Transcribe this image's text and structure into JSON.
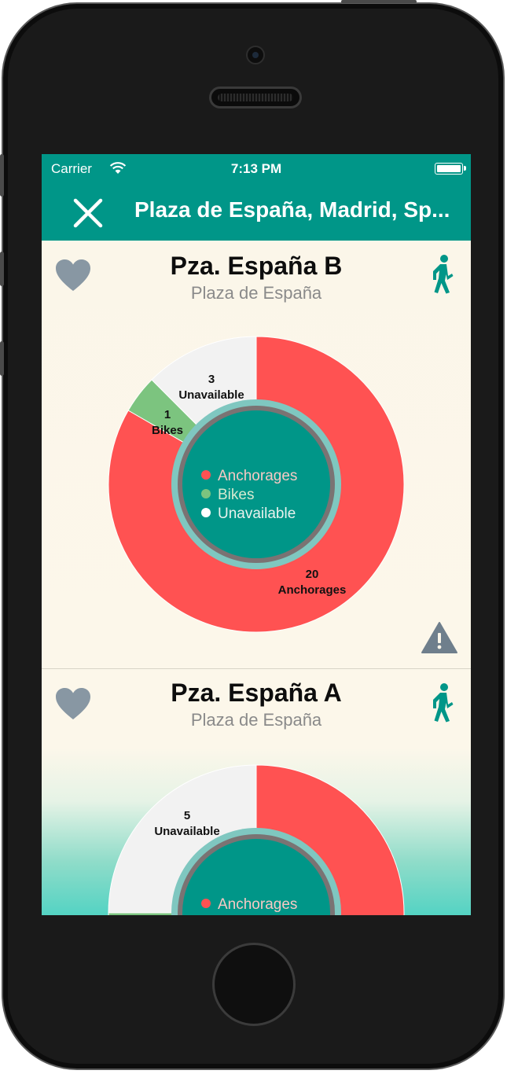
{
  "status_bar": {
    "carrier": "Carrier",
    "time": "7:13 PM"
  },
  "nav": {
    "title": "Plaza de España, Madrid, Sp...",
    "close_icon": "close-icon"
  },
  "colors": {
    "accent": "#009688",
    "anchorages": "#ff5252",
    "bikes": "#7cc47f",
    "unavailable": "#f2f2f2",
    "heart": "#8897a3",
    "warning": "#6f7f8c"
  },
  "legend": {
    "anchorages": "Anchorages",
    "bikes": "Bikes",
    "unavailable": "Unavailable"
  },
  "stations": [
    {
      "name": "Pza. España B",
      "subtitle": "Plaza de España",
      "icons": [
        "heart-icon",
        "walk-icon",
        "warning-icon"
      ],
      "chart_data": {
        "type": "pie",
        "categories": [
          "Anchorages",
          "Bikes",
          "Unavailable"
        ],
        "values": [
          20,
          1,
          3
        ],
        "labels": [
          {
            "value": "20",
            "name": "Anchorages"
          },
          {
            "value": "1",
            "name": "Bikes"
          },
          {
            "value": "3",
            "name": "Unavailable"
          }
        ]
      }
    },
    {
      "name": "Pza. España A",
      "subtitle": "Plaza de España",
      "icons": [
        "heart-icon",
        "walk-icon"
      ],
      "chart_data": {
        "type": "pie",
        "categories": [
          "Anchorages",
          "Bikes",
          "Unavailable"
        ],
        "values": [
          12,
          3,
          5
        ],
        "labels": [
          {
            "value": "5",
            "name": "Unavailable"
          }
        ]
      }
    }
  ]
}
